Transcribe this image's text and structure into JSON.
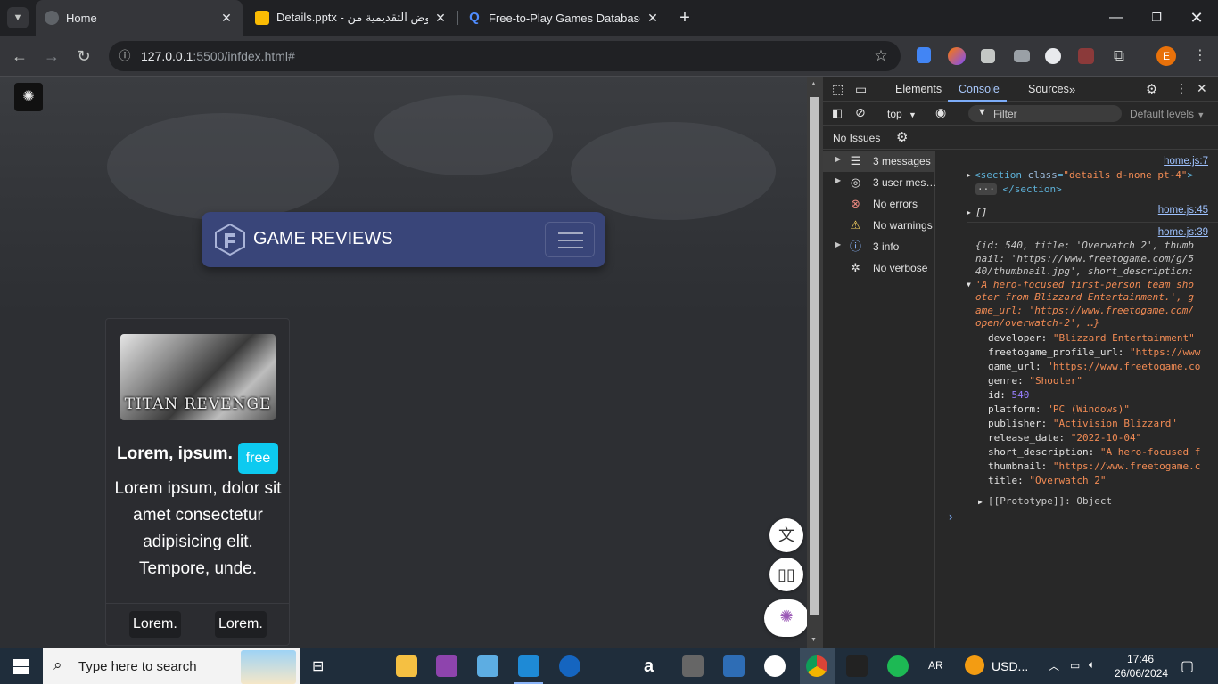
{
  "browser": {
    "tabs": [
      {
        "title": "Home",
        "active": true
      },
      {
        "title": "Details.pptx - عروض التقديمية من",
        "active": false
      },
      {
        "title": "Free-to-Play Games Database",
        "active": false
      }
    ],
    "new_tab": "+",
    "url_host": "127.0.0.1",
    "url_rest": ":5500/infdex.html#",
    "profile_initial": "E"
  },
  "page": {
    "brand": "GAME REVIEWS",
    "card": {
      "image_text": "TITAN REVENGE",
      "title": "Lorem, ipsum.",
      "badge": "free",
      "text": "Lorem ipsum, dolor sit amet consectetur adipisicing elit. Tempore, unde.",
      "footer_left": "Lorem.",
      "footer_right": "Lorem."
    }
  },
  "devtools": {
    "tabs": [
      "Elements",
      "Console",
      "Sources"
    ],
    "context": "top",
    "filter_placeholder": "Filter",
    "levels": "Default levels",
    "issues": "No Issues",
    "sidebar": [
      {
        "label": "3 messages",
        "icon": "list-icon"
      },
      {
        "label": "3 user mes…",
        "icon": "user-icon"
      },
      {
        "label": "No errors",
        "icon": "error-icon"
      },
      {
        "label": "No warnings",
        "icon": "warning-icon"
      },
      {
        "label": "3 info",
        "icon": "info-icon"
      },
      {
        "label": "No verbose",
        "icon": "bug-icon"
      }
    ],
    "console": {
      "src1": "home.js:7",
      "line1_tag": "<section ",
      "line1_attr": "class",
      "line1_val": "\"details d-none pt-4\"",
      "line1_end": ">",
      "line1b": "</section>",
      "src2": "home.js:45",
      "line2": "[]",
      "src3": "home.js:39",
      "obj_lines": [
        "{id: 540, title: 'Overwatch 2', thumb",
        "nail: 'https://www.freetogame.com/g/5",
        "40/thumbnail.jpg', short_description:",
        "'A hero-focused first-person team sho",
        "oter from Blizzard Entertainment.', g",
        "ame_url: 'https://www.freetogame.com/",
        "open/overwatch-2', …}"
      ],
      "props": [
        {
          "k": "developer",
          "v": "\"Blizzard Entertainment\""
        },
        {
          "k": "freetogame_profile_url",
          "v": "\"https://www"
        },
        {
          "k": "game_url",
          "v": "\"https://www.freetogame.co"
        },
        {
          "k": "genre",
          "v": "\"Shooter\""
        },
        {
          "k": "id",
          "v": "540"
        },
        {
          "k": "platform",
          "v": "\"PC (Windows)\""
        },
        {
          "k": "publisher",
          "v": "\"Activision Blizzard\""
        },
        {
          "k": "release_date",
          "v": "\"2022-10-04\""
        },
        {
          "k": "short_description",
          "v": "\"A hero-focused f"
        },
        {
          "k": "thumbnail",
          "v": "\"https://www.freetogame.c"
        },
        {
          "k": "title",
          "v": "\"Overwatch 2\""
        }
      ],
      "prototype": "[[Prototype]]: Object",
      "prompt": "›"
    }
  },
  "taskbar": {
    "search_placeholder": "Type here to search",
    "lang": "AR",
    "weather": "USD...",
    "time": "17:46",
    "date": "26/06/2024"
  },
  "colors": {
    "navbar": "#394579",
    "badge": "#0dcaf0",
    "console_tab_accent": "#7cacf8"
  }
}
